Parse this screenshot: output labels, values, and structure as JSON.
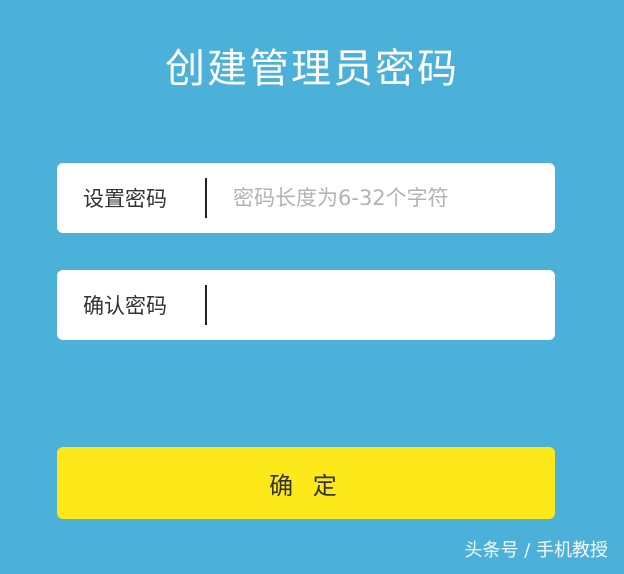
{
  "page": {
    "title": "创建管理员密码"
  },
  "form": {
    "password_label": "设置密码",
    "password_placeholder": "密码长度为6-32个字符",
    "password_value": "",
    "confirm_label": "确认密码",
    "confirm_placeholder": "",
    "confirm_value": ""
  },
  "actions": {
    "confirm_label": "确 定"
  },
  "watermark": {
    "text": "头条号 / 手机教授"
  },
  "colors": {
    "background": "#4cb1d8",
    "button": "#fde91a",
    "field": "#ffffff"
  }
}
